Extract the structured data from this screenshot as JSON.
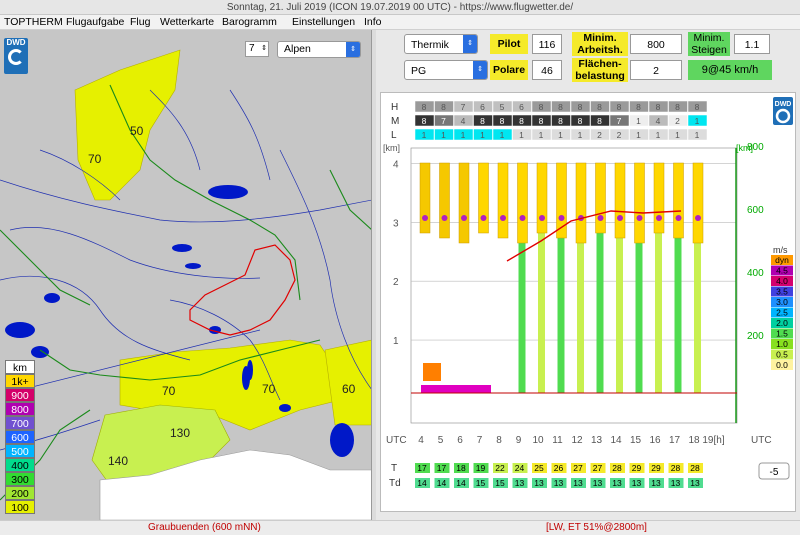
{
  "window": {
    "title": "Sonntag, 21. Juli 2019 (ICON 19.07.2019 00 UTC) - https://www.flugwetter.de/"
  },
  "menu": [
    "TOPTHERM",
    "Flugaufgabe",
    "Flug",
    "Wetterkarte",
    "Barogramm",
    "Einstellungen",
    "Info"
  ],
  "logo": {
    "text": "DWD"
  },
  "map": {
    "zoom": "7",
    "region": "Alpen",
    "legend_title": "km",
    "legend": [
      {
        "label": "1k+",
        "color": "#ffd700"
      },
      {
        "label": "900",
        "color": "#d40069"
      },
      {
        "label": "800",
        "color": "#b000b0"
      },
      {
        "label": "700",
        "color": "#7050d0"
      },
      {
        "label": "600",
        "color": "#1e64ff"
      },
      {
        "label": "500",
        "color": "#00b4ff"
      },
      {
        "label": "400",
        "color": "#00dc8c"
      },
      {
        "label": "300",
        "color": "#32dc32"
      },
      {
        "label": "200",
        "color": "#a0e632"
      },
      {
        "label": "100",
        "color": "#e6f000"
      }
    ],
    "contour_labels": [
      "50",
      "70",
      "70",
      "70",
      "60",
      "130",
      "140"
    ]
  },
  "controls": {
    "thermik_select": "Thermik",
    "pg_select": "PG",
    "pilot_label": "Pilot",
    "pilot_value": "116",
    "polare_label": "Polare",
    "polare_value": "46",
    "min_arbeit_label": "Minim. Arbeitsh.",
    "min_arbeit_value": "800",
    "flaechen_label": "Flächen-belastung",
    "flaechen_value": "2",
    "min_steigen_label": "Minim. Steigen",
    "min_steigen_value": "1.1",
    "result": "9@45 km/h"
  },
  "chart_data": {
    "type": "heatmap",
    "cloud_rows": [
      "H",
      "M",
      "L"
    ],
    "cloud_H": [
      "8",
      "8",
      "7",
      "6",
      "5",
      "6",
      "8",
      "8",
      "8",
      "8",
      "8",
      "8",
      "8",
      "8",
      "8"
    ],
    "cloud_M": [
      "8",
      "7",
      "4",
      "8",
      "8",
      "8",
      "8",
      "8",
      "8",
      "8",
      "7",
      "1",
      "4",
      "2",
      "1"
    ],
    "cloud_L": [
      "1",
      "1",
      "1",
      "1",
      "1",
      "1",
      "1",
      "1",
      "1",
      "2",
      "2",
      "1",
      "1",
      "1",
      "1"
    ],
    "y_left_label": "[km]",
    "y_left_ticks": [
      "1",
      "2",
      "3",
      "4"
    ],
    "y_right_label": "[km]",
    "y_right_ticks": [
      "200",
      "400",
      "600",
      "800"
    ],
    "x_label": "UTC",
    "x_ticks": [
      "4",
      "5",
      "6",
      "7",
      "8",
      "9",
      "10",
      "11",
      "12",
      "13",
      "14",
      "15",
      "16",
      "17",
      "18",
      "19[h]"
    ],
    "climb_label": "m/s",
    "climb_scale": [
      {
        "label": "dyn",
        "color": "#ff9900"
      },
      {
        "label": "4.5",
        "color": "#b000b0"
      },
      {
        "label": "4.0",
        "color": "#d4006e"
      },
      {
        "label": "3.5",
        "color": "#4040e0"
      },
      {
        "label": "3.0",
        "color": "#1e90ff"
      },
      {
        "label": "2.5",
        "color": "#00b4ff"
      },
      {
        "label": "2.0",
        "color": "#00d0a0"
      },
      {
        "label": "1.5",
        "color": "#50dc50"
      },
      {
        "label": "1.0",
        "color": "#88e020"
      },
      {
        "label": "0.5",
        "color": "#c8f050"
      },
      {
        "label": "0.0",
        "color": "#fff2a0"
      }
    ],
    "temperature_T": [
      "17",
      "17",
      "18",
      "19",
      "22",
      "24",
      "25",
      "26",
      "27",
      "27",
      "28",
      "29",
      "29",
      "28",
      "28"
    ],
    "dewpoint_Td": [
      "14",
      "14",
      "14",
      "15",
      "15",
      "13",
      "13",
      "13",
      "13",
      "13",
      "13",
      "13",
      "13",
      "13",
      "13"
    ],
    "row_label_T": "T",
    "row_label_Td": "Td",
    "time_offset": "-5"
  },
  "status": {
    "left": "Graubuenden (600 mNN)",
    "right": "[LW, ET  51%@2800m]"
  }
}
